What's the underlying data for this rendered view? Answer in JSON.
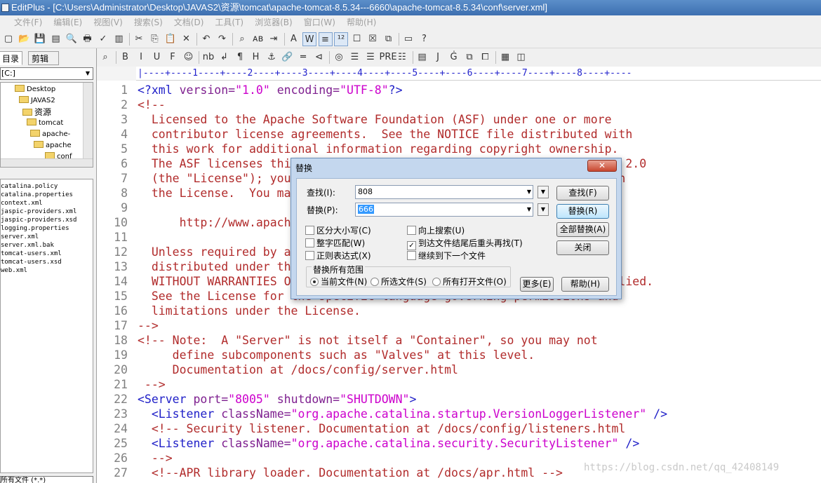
{
  "window": {
    "title": "EditPlus - [C:\\Users\\Administrator\\Desktop\\JAVAS2\\资源\\tomcat\\apache-tomcat-8.5.34---6660\\apache-tomcat-8.5.34\\conf\\server.xml]"
  },
  "menu": [
    "文件(F)",
    "编辑(E)",
    "视图(V)",
    "搜索(S)",
    "文档(D)",
    "工具(T)",
    "浏览器(B)",
    "窗口(W)",
    "帮助(H)"
  ],
  "toolbar1": {
    "icons": [
      "new-file-icon",
      "open-icon",
      "save-icon",
      "save-all-icon",
      "print-preview-icon",
      "print-icon",
      "spell-check-icon",
      "browser-view-icon",
      "cut-icon",
      "copy-icon",
      "paste-icon",
      "delete-icon",
      "undo-icon",
      "redo-icon",
      "find-icon",
      "replace-icon",
      "goto-icon",
      "font-icon",
      "word-wrap-icon",
      "ruler-icon",
      "line-number-icon",
      "toggle-icon",
      "cliptext-icon",
      "panel-icon",
      "output-icon",
      "help-icon"
    ],
    "glyphs": [
      "▢",
      "📂",
      "💾",
      "▤",
      "🔍",
      "🖶",
      "✓",
      "▥",
      "✂",
      "⎘",
      "📋",
      "✕",
      "↶",
      "↷",
      "⌕",
      "ᴀʙ",
      "⇥",
      "A",
      "W",
      "≡",
      "¹²",
      "☐",
      "☒",
      "⧉",
      "▭",
      "?"
    ]
  },
  "toolbar2": {
    "icons": [
      "browser-icon",
      "bold-icon",
      "italic-icon",
      "underline-icon",
      "font-html-icon",
      "color-icon",
      "nbsp-icon",
      "br-icon",
      "paragraph-icon",
      "heading-icon",
      "anchor-icon",
      "link-icon",
      "hr-icon",
      "comment-icon",
      "image-icon",
      "table-icon",
      "center-icon",
      "pre-icon",
      "list-icon",
      "form-icon",
      "java-icon",
      "script-icon",
      "style-icon",
      "frame-icon",
      "color-picker-icon",
      "layout-icon"
    ],
    "glyphs": [
      "⌕",
      "B",
      "I",
      "U",
      "F",
      "☺",
      "nb",
      "↲",
      "¶",
      "H",
      "⚓",
      "🔗",
      "═",
      "⊲",
      "◎",
      "☰",
      "☰",
      "PRE",
      "☷",
      "▤",
      "J",
      "Ġ",
      "⧉",
      "⧠",
      "▦",
      "◫"
    ]
  },
  "left_panel": {
    "tabs": [
      "目录",
      "剪辑"
    ],
    "drive": "[C:]",
    "tree": [
      "Desktop",
      "JAVAS2",
      "资源",
      "tomcat",
      "apache-",
      "apache",
      "conf"
    ],
    "files": [
      "catalina.policy",
      "catalina.properties",
      "context.xml",
      "jaspic-providers.xml",
      "jaspic-providers.xsd",
      "logging.properties",
      "server.xml",
      "server.xml.bak",
      "tomcat-users.xml",
      "tomcat-users.xsd",
      "web.xml"
    ],
    "filter": "所有文件 (*.*)"
  },
  "ruler": "|----+----1----+----2----+----3----+----4----+----5----+----6----+----7----+----8----+----",
  "editor": {
    "lines": [
      {
        "n": "1",
        "segs": [
          {
            "t": "<?xml ",
            "c": "tag"
          },
          {
            "t": "version=",
            "c": "attr"
          },
          {
            "t": "\"1.0\"",
            "c": "val"
          },
          {
            "t": " encoding=",
            "c": "attr"
          },
          {
            "t": "\"UTF-8\"",
            "c": "val"
          },
          {
            "t": "?>",
            "c": "tag"
          }
        ]
      },
      {
        "n": "2",
        "segs": [
          {
            "t": "<!--",
            "c": "cm"
          }
        ]
      },
      {
        "n": "3",
        "segs": [
          {
            "t": "  Licensed to the Apache Software Foundation (ASF) under one or more",
            "c": "cm"
          }
        ]
      },
      {
        "n": "4",
        "segs": [
          {
            "t": "  contributor license agreements.  See the NOTICE file distributed with",
            "c": "cm"
          }
        ]
      },
      {
        "n": "5",
        "segs": [
          {
            "t": "  this work for additional information regarding copyright ownership.",
            "c": "cm"
          }
        ]
      },
      {
        "n": "6",
        "segs": [
          {
            "t": "  The ASF licenses this file to You under the Apache License, Version 2.0",
            "c": "cm"
          }
        ]
      },
      {
        "n": "7",
        "segs": [
          {
            "t": "  (the \"License\"); you may not use this file except in compliance with",
            "c": "cm"
          }
        ]
      },
      {
        "n": "8",
        "segs": [
          {
            "t": "  the License.  You may obtain a copy of the License at",
            "c": "cm"
          }
        ]
      },
      {
        "n": "9",
        "segs": []
      },
      {
        "n": "10",
        "segs": [
          {
            "t": "      http://www.apache.org/licenses/LICENSE-2.0",
            "c": "cm"
          }
        ]
      },
      {
        "n": "11",
        "segs": []
      },
      {
        "n": "12",
        "segs": [
          {
            "t": "  Unless required by applicable law or agreed to in writing, software",
            "c": "cm"
          }
        ]
      },
      {
        "n": "13",
        "segs": [
          {
            "t": "  distributed under the License is distributed on an \"AS IS\" BASIS,",
            "c": "cm"
          }
        ]
      },
      {
        "n": "14",
        "segs": [
          {
            "t": "  WITHOUT WARRANTIES OR CONDITIONS OF ANY KIND, either express or implied.",
            "c": "cm"
          }
        ]
      },
      {
        "n": "15",
        "segs": [
          {
            "t": "  See the License for the specific language governing permissions and",
            "c": "cm"
          }
        ]
      },
      {
        "n": "16",
        "segs": [
          {
            "t": "  limitations under the License.",
            "c": "cm"
          }
        ]
      },
      {
        "n": "17",
        "segs": [
          {
            "t": "-->",
            "c": "cm"
          }
        ]
      },
      {
        "n": "18",
        "segs": [
          {
            "t": "<!-- Note:  A \"Server\" is not itself a \"Container\", so you may not",
            "c": "cm"
          }
        ]
      },
      {
        "n": "19",
        "segs": [
          {
            "t": "     define subcomponents such as \"Valves\" at this level.",
            "c": "cm"
          }
        ]
      },
      {
        "n": "20",
        "segs": [
          {
            "t": "     Documentation at /docs/config/server.html",
            "c": "cm"
          }
        ]
      },
      {
        "n": "21",
        "segs": [
          {
            "t": " -->",
            "c": "cm"
          }
        ]
      },
      {
        "n": "22",
        "segs": [
          {
            "t": "<Server ",
            "c": "tag"
          },
          {
            "t": "port=",
            "c": "attr"
          },
          {
            "t": "\"8005\"",
            "c": "val"
          },
          {
            "t": " shutdown=",
            "c": "attr"
          },
          {
            "t": "\"SHUTDOWN\"",
            "c": "val"
          },
          {
            "t": ">",
            "c": "tag"
          }
        ]
      },
      {
        "n": "23",
        "segs": [
          {
            "t": "  <Listener ",
            "c": "tag"
          },
          {
            "t": "className=",
            "c": "attr"
          },
          {
            "t": "\"org.apache.catalina.startup.VersionLoggerListener\"",
            "c": "val"
          },
          {
            "t": " />",
            "c": "tag"
          }
        ]
      },
      {
        "n": "24",
        "segs": [
          {
            "t": "  <!-- Security listener. Documentation at /docs/config/listeners.html",
            "c": "cm"
          }
        ]
      },
      {
        "n": "25",
        "segs": [
          {
            "t": "  <Listener ",
            "c": "tag"
          },
          {
            "t": "className=",
            "c": "attr"
          },
          {
            "t": "\"org.apache.catalina.security.SecurityListener\"",
            "c": "val"
          },
          {
            "t": " />",
            "c": "tag"
          }
        ]
      },
      {
        "n": "26",
        "segs": [
          {
            "t": "  -->",
            "c": "cm"
          }
        ]
      },
      {
        "n": "27",
        "segs": [
          {
            "t": "  <!--APR library loader. Documentation at /docs/apr.html -->",
            "c": "cm"
          }
        ]
      }
    ]
  },
  "watermark": "https://blog.csdn.net/qq_42408149",
  "dialog": {
    "title": "替换",
    "close": "✕",
    "find_label": "查找(I):",
    "find_value": "808",
    "replace_label": "替换(P):",
    "replace_value": "666",
    "options": {
      "match_case": "区分大小写(C)",
      "whole_word": "整字匹配(W)",
      "regex": "正则表达式(X)",
      "search_up": "向上搜索(U)",
      "wrap": "到达文件结尾后重头再找(T)",
      "next_file": "继续到下一个文件"
    },
    "scope_title": "替换所有范围",
    "scope": {
      "current": "当前文件(N)",
      "selected": "所选文件(S)",
      "all_open": "所有打开文件(O)"
    },
    "buttons": {
      "find": "查找(F)",
      "replace": "替换(R)",
      "replace_all": "全部替换(A)",
      "close": "关闭",
      "more": "更多(E)",
      "help": "帮助(H)"
    }
  }
}
